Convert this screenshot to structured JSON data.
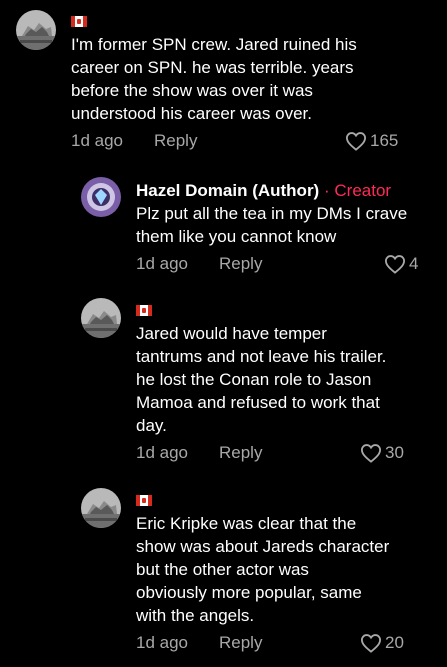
{
  "comments": [
    {
      "flag": "Canada flag",
      "text": "I'm former SPN crew. Jared ruined his\ncareer on SPN. he was terrible. years\nbefore the show was over it was\nunderstood his career was over.",
      "time": "1d ago",
      "reply_label": "Reply",
      "likes": "165"
    }
  ],
  "replies": [
    {
      "author": "Hazel Domain (Author)",
      "separator": "·",
      "badge": "Creator",
      "text": "Plz put all the tea in my DMs I crave\nthem like you cannot know",
      "time": "1d ago",
      "reply_label": "Reply",
      "likes": "4"
    },
    {
      "flag": "Canada flag",
      "text": "Jared would have temper\ntantrums and not leave his trailer.\nhe lost the Conan role to Jason\nMamoa and refused to work that\nday.",
      "time": "1d ago",
      "reply_label": "Reply",
      "likes": "30"
    },
    {
      "flag": "Canada flag",
      "text": "Eric Kripke was clear that the\nshow was about Jareds character\nbut the other actor was\nobviously more popular, same\nwith the angels.",
      "time": "1d ago",
      "reply_label": "Reply",
      "likes": "20"
    }
  ],
  "colors": {
    "background": "#000000",
    "text": "#ffffff",
    "muted": "#a8a8a8",
    "creator": "#fe2c55"
  },
  "icons": {
    "like": "heart-outline-icon",
    "flag": "canada-flag-icon"
  }
}
